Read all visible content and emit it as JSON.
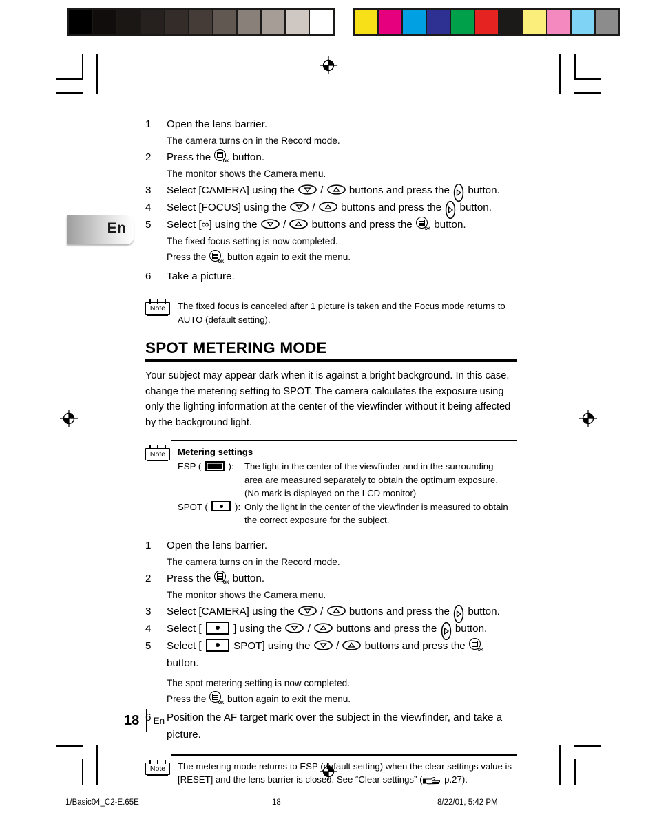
{
  "calibration": {
    "gray_bar": [
      "#000000",
      "#100d0c",
      "#1b1715",
      "#26211e",
      "#332c28",
      "#453c37",
      "#625852",
      "#8a807a",
      "#a79d97",
      "#cfc7c2",
      "#ffffff"
    ],
    "color_bar": [
      "#f7e017",
      "#e6007e",
      "#00a0e3",
      "#2e3192",
      "#00a04b",
      "#e52421",
      "#1c1a18",
      "#fbee7a",
      "#f489bf",
      "#7fd4f5",
      "#8c8c8c"
    ]
  },
  "lang_tab": {
    "label": "En"
  },
  "section_one": {
    "steps": [
      {
        "num": "1",
        "text": "Open the lens barrier."
      },
      {
        "sub": "The camera turns on in the Record mode."
      },
      {
        "num": "2",
        "pre": "Press the ",
        "icon": "menu-ok-button-icon",
        "post": " button."
      },
      {
        "sub": "The monitor shows the Camera menu."
      },
      {
        "num": "3",
        "text": "Select [CAMERA] using the ▽ / △ buttons and press the ▷ button."
      },
      {
        "num": "4",
        "text": "Select [FOCUS] using the ▽ / △ buttons and press the ▷ button."
      },
      {
        "num": "5",
        "text": "Select [∞] using the ▽ / △ buttons and press the MENU button."
      },
      {
        "sub": "The fixed focus setting is now completed."
      },
      {
        "sub": "Press the MENU button again to exit the menu."
      },
      {
        "num": "6",
        "text": "Take a picture."
      }
    ],
    "step3": {
      "a": "Select [CAMERA] using the ",
      "b": " / ",
      "c": " buttons and press the ",
      "d": " button."
    },
    "step4": {
      "a": "Select [FOCUS] using the ",
      "b": " / ",
      "c": " buttons and press the ",
      "d": " button."
    },
    "step5": {
      "a": "Select [∞] using the ",
      "b": " / ",
      "c": " buttons and press the ",
      "d": " button."
    },
    "step1_num": "1",
    "step1_text": "Open the lens barrier.",
    "step1_sub": "The camera turns on in the Record mode.",
    "step2_num": "2",
    "step2_pre": "Press the ",
    "step2_post": " button.",
    "step2_sub": "The monitor shows the Camera menu.",
    "step3_num": "3",
    "step4_num": "4",
    "step5_num": "5",
    "step5_sub1": "The fixed focus setting is now completed.",
    "step5_sub2_pre": "Press the ",
    "step5_sub2_post": " button again to exit the menu.",
    "step6_num": "6",
    "step6_text": "Take a picture.",
    "note": {
      "badge": "Note",
      "text": "The fixed focus is canceled after 1 picture is taken and the Focus mode returns to AUTO (default setting)."
    }
  },
  "spot_section": {
    "heading": "SPOT METERING MODE",
    "paragraph": "Your subject may appear dark when it is against a bright background. In this case, change the metering setting to SPOT. The camera calculates the exposure using only the lighting information at the center of the viewfinder without it being affected by the background light.",
    "settings_note": {
      "badge": "Note",
      "title": "Metering settings",
      "esp_term_pre": "ESP ( ",
      "esp_term_post": " ):",
      "esp_desc_line1": "The light in the center of the viewfinder and in the surrounding",
      "esp_desc_line2": "area are measured separately to obtain the optimum exposure.",
      "esp_desc_line3": "(No mark is  displayed on the LCD monitor)",
      "spot_term_pre": "SPOT ( ",
      "spot_term_post": " ):",
      "spot_desc_line1": "Only the light in the center of the viewfinder is measured to obtain",
      "spot_desc_line2": "the correct exposure for the subject."
    },
    "step1_num": "1",
    "step1_text": "Open the lens barrier.",
    "step1_sub": "The camera turns on in the Record mode.",
    "step2_num": "2",
    "step2_pre": "Press the ",
    "step2_post": " button.",
    "step2_sub": "The monitor shows the Camera menu.",
    "step3_num": "3",
    "step3_a": "Select [CAMERA] using the ",
    "step3_b": " / ",
    "step3_c": " buttons and press the ",
    "step3_d": " button.",
    "step4_num": "4",
    "step4_a": "Select [ ",
    "step4_b": " ] using the ",
    "step4_c": " / ",
    "step4_d": " buttons and press the ",
    "step4_e": " button.",
    "step5_num": "5",
    "step5_a": "Select [ ",
    "step5_b": " SPOT] using the ",
    "step5_c": " / ",
    "step5_d": " buttons and press the ",
    "step5_e": " button.",
    "step5_sub1": "The spot metering setting is now completed.",
    "step5_sub2_pre": "Press the ",
    "step5_sub2_post": " button again to exit the menu.",
    "step6_num": "6",
    "step6_text": "Position the AF target mark over the subject in the viewfinder, and take a picture.",
    "note": {
      "badge": "Note",
      "text_pre": "The metering mode returns to ESP (default setting) when the clear settings value is [RESET] and the lens barrier is closed. See “Clear settings” (",
      "text_post": " p.27)."
    }
  },
  "page_footer": {
    "number": "18",
    "lang": "En"
  },
  "print_footer": {
    "file": "1/Basic04_C2-E.65E",
    "page": "18",
    "timestamp": "8/22/01, 5:42 PM"
  }
}
